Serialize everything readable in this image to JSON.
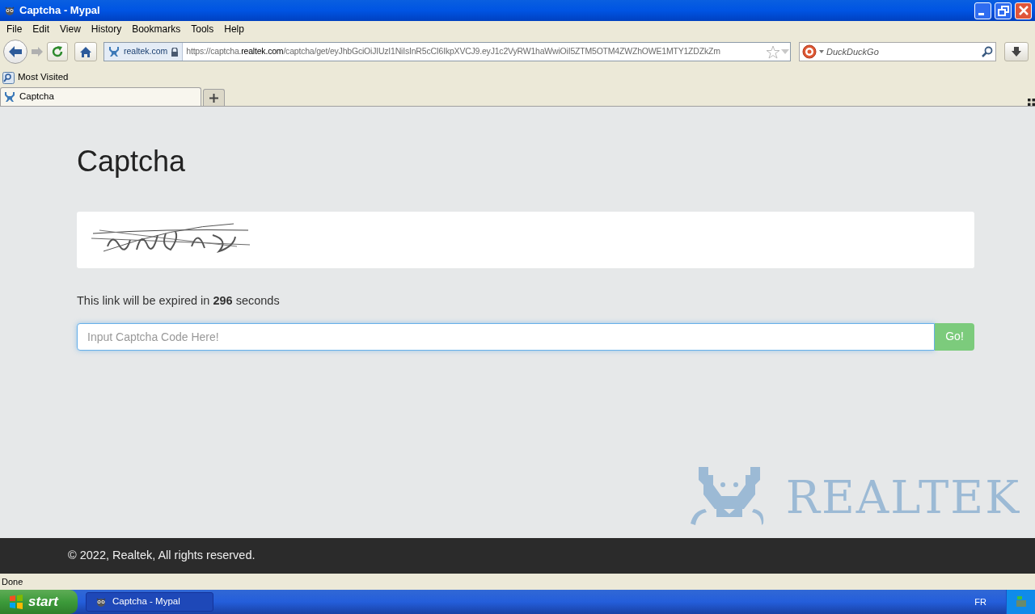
{
  "window": {
    "title": "Captcha - Mypal"
  },
  "menu": [
    "File",
    "Edit",
    "View",
    "History",
    "Bookmarks",
    "Tools",
    "Help"
  ],
  "toolbar": {
    "site_identity": "realtek.com",
    "url": "https://captcha.**realtek.com**/captcha/get/eyJhbGciOiJIUzI1NiIsInR5cCI6IkpXVCJ9.eyJ1c2VyRW1haWwiOiI5ZTM5OTM4ZWZhOWE1MTY1ZDZkZm",
    "search_placeholder": "DuckDuckGo"
  },
  "bookmarks": [
    "Most Visited"
  ],
  "tabs": [
    {
      "label": "Captcha",
      "selected": true
    }
  ],
  "page": {
    "heading": "Captcha",
    "expiry": "This link will be expired in **296** seconds",
    "input": {
      "placeholder": "Input Captcha Code Here!"
    },
    "button": "Go!",
    "logo_text": "REALTEK",
    "footer": "© 2022, Realtek, All rights reserved."
  },
  "status_bar": "Done",
  "taskbar": {
    "start": "start",
    "tasks": [
      {
        "label": "Captcha - Mypal",
        "selected": true
      }
    ],
    "language": "FR"
  }
}
